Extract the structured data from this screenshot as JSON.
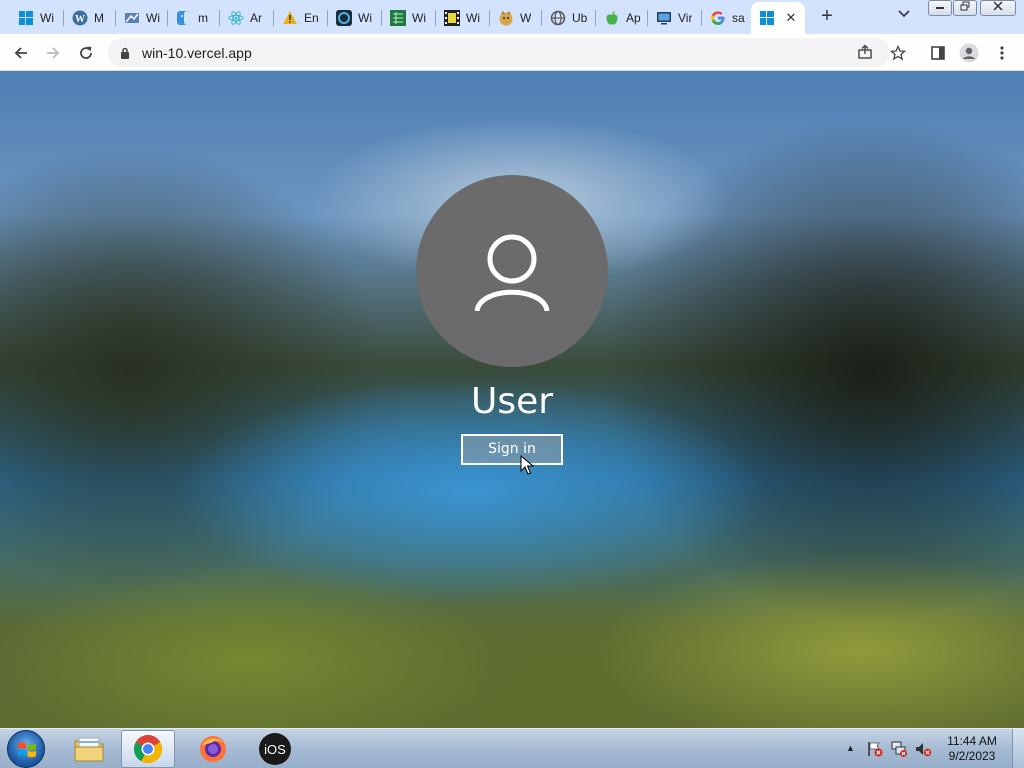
{
  "browser": {
    "tabs": [
      {
        "title": "Wi",
        "icon": "windows-logo-icon"
      },
      {
        "title": "M",
        "icon": "wordpress-icon"
      },
      {
        "title": "Wi",
        "icon": "app-icon"
      },
      {
        "title": "m",
        "icon": "finder-icon"
      },
      {
        "title": "Ar",
        "icon": "react-icon"
      },
      {
        "title": "En",
        "icon": "warning-icon"
      },
      {
        "title": "Wi",
        "icon": "app-icon"
      },
      {
        "title": "Wi",
        "icon": "spreadsheet-icon"
      },
      {
        "title": "Wi",
        "icon": "film-icon"
      },
      {
        "title": "W",
        "icon": "doge-icon"
      },
      {
        "title": "Ub",
        "icon": "globe-icon"
      },
      {
        "title": "Ap",
        "icon": "apple-icon"
      },
      {
        "title": "Vir",
        "icon": "monitor-icon"
      },
      {
        "title": "sa",
        "icon": "google-icon"
      },
      {
        "title": "",
        "icon": "windows-logo-icon",
        "active": true
      }
    ],
    "new_tab": "+",
    "url": "win-10.vercel.app"
  },
  "lockscreen": {
    "username": "User",
    "sign_in_label": "Sign in"
  },
  "taskbar": {
    "apps": [
      "explorer",
      "chrome",
      "firefox",
      "iOS"
    ],
    "ios_label": "iOS",
    "clock_time": "11:44 AM",
    "clock_date": "9/2/2023"
  },
  "colors": {
    "tabstrip": "#d3e3fd",
    "avatar": "#6b6b6b",
    "taskbar": "#a6bad2"
  }
}
